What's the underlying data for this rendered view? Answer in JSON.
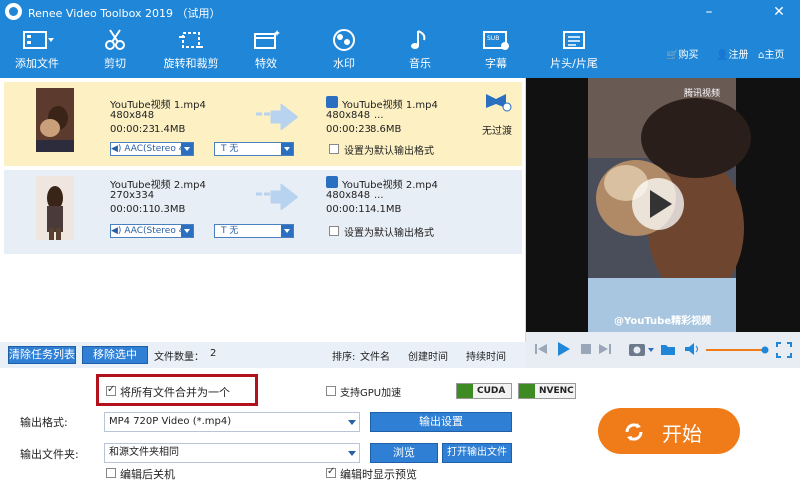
{
  "app": {
    "title": "Renee Video Toolbox 2019 （试用）",
    "minimize": "–",
    "close": "✕"
  },
  "toolbar": {
    "items": [
      {
        "label": "添加文件",
        "icon": "add-file-icon"
      },
      {
        "label": "剪切",
        "icon": "scissors-icon"
      },
      {
        "label": "旋转和裁剪",
        "icon": "rotate-crop-icon"
      },
      {
        "label": "特效",
        "icon": "effects-icon"
      },
      {
        "label": "水印",
        "icon": "watermark-icon"
      },
      {
        "label": "音乐",
        "icon": "music-note-icon"
      },
      {
        "label": "字幕",
        "icon": "subtitle-icon"
      },
      {
        "label": "片头/片尾",
        "icon": "intro-outro-icon"
      }
    ],
    "buy": "购买",
    "register": "注册",
    "home": "主页"
  },
  "files": [
    {
      "in_name": "YouTube视频 1.mp4",
      "in_res": "480x848",
      "in_dur": "00:00:23",
      "in_size": "1.4MB",
      "out_name": "YouTube视频 1.mp4",
      "out_res": "480x848",
      "out_extra": "...",
      "out_dur": "00:00:23",
      "out_size": "8.6MB",
      "audio": "AAC(Stereo 4",
      "subtitle": "无",
      "set_default": "设置为默认输出格式",
      "transition": "无过渡",
      "selected": true
    },
    {
      "in_name": "YouTube视频 2.mp4",
      "in_res": "270x334",
      "in_dur": "00:00:11",
      "in_size": "0.3MB",
      "out_name": "YouTube视频 2.mp4",
      "out_res": "480x848",
      "out_extra": "...",
      "out_dur": "00:00:11",
      "out_size": "4.1MB",
      "audio": "AAC(Stereo 4",
      "subtitle": "无",
      "set_default": "设置为默认输出格式",
      "selected": false
    }
  ],
  "listbar": {
    "clear": "清除任务列表",
    "remove": "移除选中",
    "count_label": "文件数量：",
    "count": "2",
    "sort_label": "排序:",
    "sort_name": "文件名",
    "sort_created": "创建时间",
    "sort_duration": "持续时间"
  },
  "preview": {
    "watermark_top": "腾讯视频",
    "caption": "@YouTube精彩视频"
  },
  "settings": {
    "merge_all": "将所有文件合并为一个",
    "merge_checked": true,
    "gpu": "支持GPU加速",
    "gpu_checked": false,
    "cuda": "CUDA",
    "nvenc": "NVENC",
    "format_label": "输出格式:",
    "format_value": "MP4 720P Video (*.mp4)",
    "output_settings": "输出设置",
    "folder_label": "输出文件夹:",
    "folder_value": "和源文件夹相同",
    "browse": "浏览",
    "open_folder": "打开输出文件",
    "shutdown": "编辑后关机",
    "shutdown_checked": false,
    "show_preview": "编辑时显示预览",
    "show_preview_checked": true,
    "start": "开始"
  },
  "colors": {
    "accent": "#1f86d8",
    "selected_row": "#fdf1c4",
    "start": "#f07b19",
    "highlight_box": "#b3121d"
  }
}
